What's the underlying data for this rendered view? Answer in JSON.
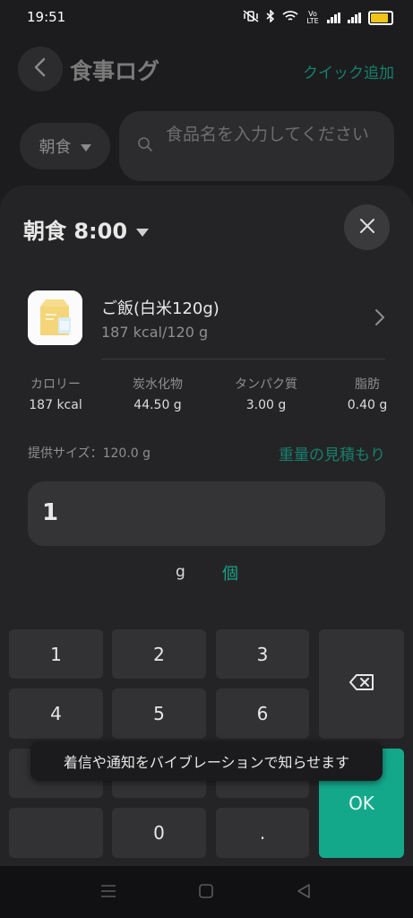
{
  "status": {
    "time": "19:51",
    "network_label": "Vo LTE"
  },
  "header": {
    "title": "食事ログ",
    "quick_add": "クイック追加"
  },
  "meal_chip": {
    "label": "朝食"
  },
  "search": {
    "placeholder": "食品名を入力してください"
  },
  "sheet": {
    "title": "朝食 8:00"
  },
  "food": {
    "name": "ご飯(白米120g)",
    "subtitle": "187 kcal/120 g"
  },
  "nutrients": [
    {
      "label": "カロリー",
      "value": "187 kcal"
    },
    {
      "label": "炭水化物",
      "value": "44.50 g"
    },
    {
      "label": "タンパク質",
      "value": "3.00 g"
    },
    {
      "label": "脂肪",
      "value": "0.40 g"
    }
  ],
  "serving": {
    "text": "提供サイズ：120.0 g",
    "estimate_link": "重量の見積もり"
  },
  "quantity": {
    "value": "1"
  },
  "units": {
    "grams": "g",
    "pieces": "個",
    "selected": "個"
  },
  "keypad": {
    "k1": "1",
    "k2": "2",
    "k3": "3",
    "k4": "4",
    "k5": "5",
    "k6": "6",
    "k0": "0",
    "dot": ".",
    "ok": "OK"
  },
  "toast": {
    "text": "着信や通知をバイブレーションで知らせます"
  },
  "colors": {
    "accent": "#14a88b",
    "background": "#1c1c1e",
    "sheet": "#242426"
  }
}
